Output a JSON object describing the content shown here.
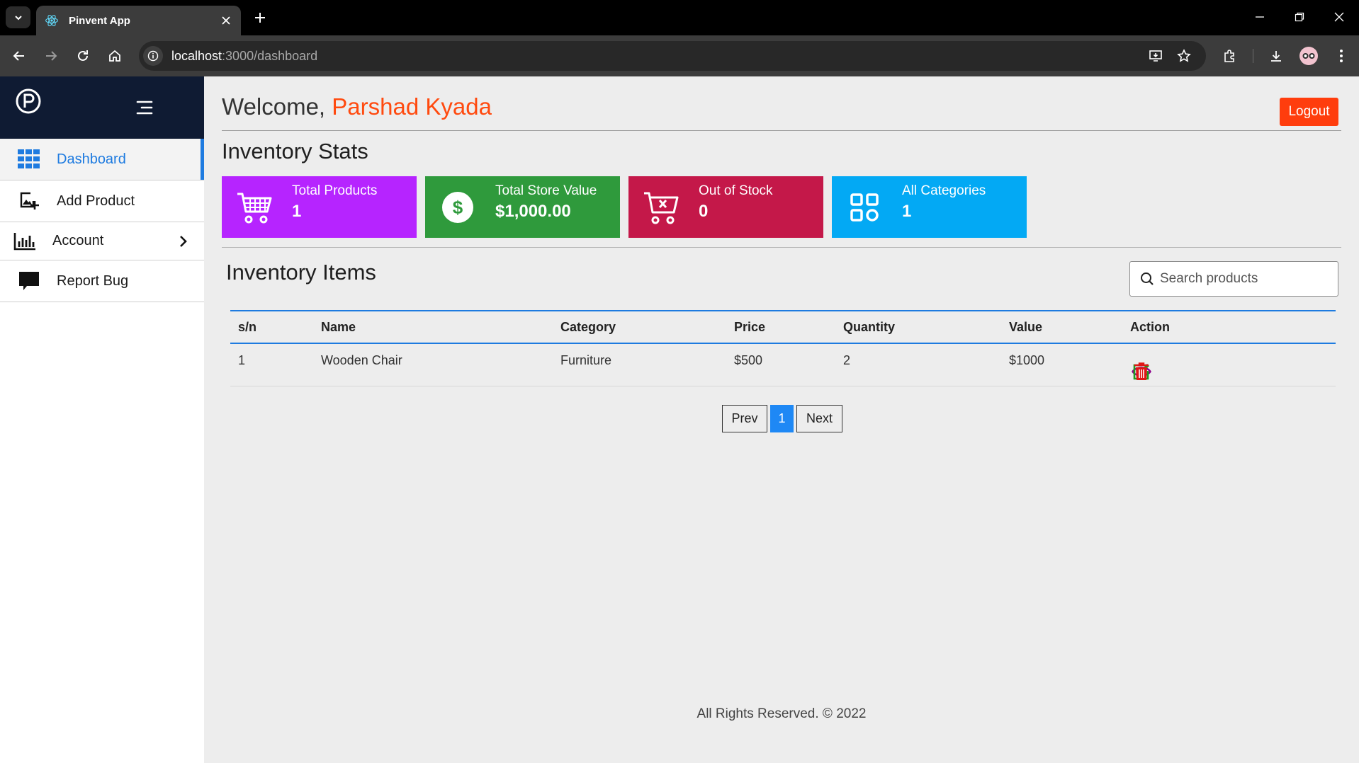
{
  "browser": {
    "tab_title": "Pinvent App",
    "url_host": "localhost",
    "url_path": ":3000/dashboard"
  },
  "sidebar": {
    "items": [
      {
        "label": "Dashboard",
        "icon": "grid-icon",
        "active": true
      },
      {
        "label": "Add Product",
        "icon": "add-image-icon"
      },
      {
        "label": "Account",
        "icon": "bar-chart-icon",
        "has_submenu": true
      },
      {
        "label": "Report Bug",
        "icon": "chat-bubble-icon"
      }
    ]
  },
  "header": {
    "welcome": "Welcome,",
    "user_name": "Parshad Kyada",
    "logout_label": "Logout"
  },
  "stats": {
    "title": "Inventory Stats",
    "cards": [
      {
        "label": "Total Products",
        "value": "1",
        "color": "#b624ff",
        "icon": "cart-icon"
      },
      {
        "label": "Total Store Value",
        "value": "$1,000.00",
        "color": "#2f9a3c",
        "icon": "dollar-icon"
      },
      {
        "label": "Out of Stock",
        "value": "0",
        "color": "#c41849",
        "icon": "cart-remove-icon"
      },
      {
        "label": "All Categories",
        "value": "1",
        "color": "#03a9f4",
        "icon": "categories-icon"
      }
    ]
  },
  "inventory": {
    "title": "Inventory Items",
    "search_placeholder": "Search products",
    "columns": [
      "s/n",
      "Name",
      "Category",
      "Price",
      "Quantity",
      "Value",
      "Action"
    ],
    "rows": [
      {
        "sn": "1",
        "name": "Wooden Chair",
        "category": "Furniture",
        "price": "$500",
        "quantity": "2",
        "value": "$1000"
      }
    ]
  },
  "pagination": {
    "prev": "Prev",
    "current": "1",
    "next": "Next"
  },
  "footer": {
    "text": "All Rights Reserved. © 2022"
  },
  "colors": {
    "accent": "#1e7be0",
    "brand_orange": "#ff4a0f",
    "sidebar_dark": "#0f1b33"
  }
}
